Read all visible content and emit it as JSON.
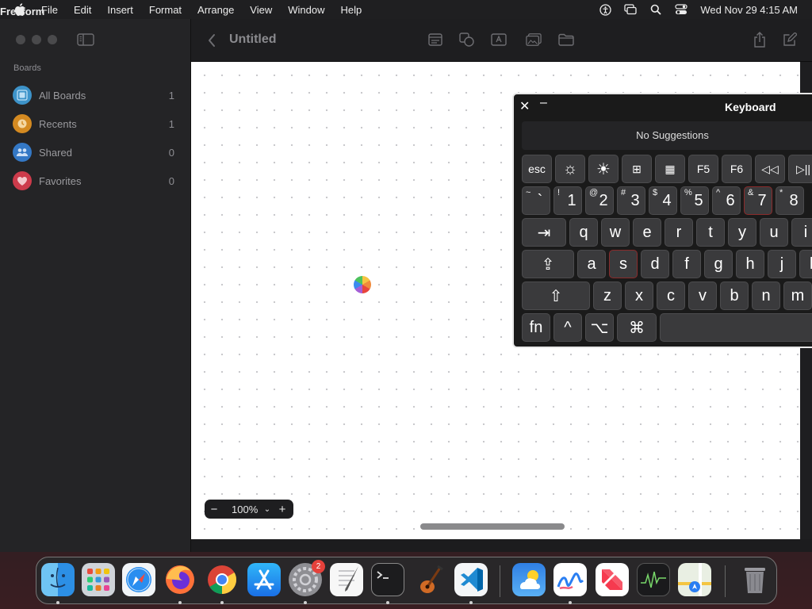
{
  "menubar": {
    "app_name": "Freeform",
    "items": [
      "File",
      "Edit",
      "Insert",
      "Format",
      "Arrange",
      "View",
      "Window",
      "Help"
    ],
    "clock": "Wed Nov 29  4:15 AM"
  },
  "sidebar": {
    "heading": "Boards",
    "items": [
      {
        "label": "All Boards",
        "count": "1",
        "color": "#3d93c9",
        "icon": "grid-boards-icon"
      },
      {
        "label": "Recents",
        "count": "1",
        "color": "#d48a21",
        "icon": "clock-icon"
      },
      {
        "label": "Shared",
        "count": "0",
        "color": "#3478c5",
        "icon": "people-icon"
      },
      {
        "label": "Favorites",
        "count": "0",
        "color": "#cd3b4b",
        "icon": "heart-icon"
      }
    ]
  },
  "toolbar": {
    "title": "Untitled"
  },
  "zoom": {
    "minus": "−",
    "value": "100%",
    "plus": "+"
  },
  "keyboard": {
    "title": "Keyboard",
    "close": "✕",
    "minimize": "–",
    "suggestions": "No Suggestions",
    "fn_row": [
      "esc",
      "☼",
      "☀",
      "⊞",
      "▦",
      "F5",
      "F6",
      "◁◁",
      "▷||"
    ],
    "number_row": [
      {
        "sym": "~",
        "main": "`"
      },
      {
        "sym": "!",
        "main": "1"
      },
      {
        "sym": "@",
        "main": "2"
      },
      {
        "sym": "#",
        "main": "3"
      },
      {
        "sym": "$",
        "main": "4"
      },
      {
        "sym": "%",
        "main": "5"
      },
      {
        "sym": "^",
        "main": "6"
      },
      {
        "sym": "&",
        "main": "7"
      },
      {
        "sym": "*",
        "main": "8"
      }
    ],
    "qwerty_row": [
      "⇥",
      "q",
      "w",
      "e",
      "r",
      "t",
      "y",
      "u",
      "i"
    ],
    "home_row": [
      "⇪",
      "a",
      "s",
      "d",
      "f",
      "g",
      "h",
      "j",
      "k"
    ],
    "shift_row": [
      "⇧",
      "z",
      "x",
      "c",
      "v",
      "b",
      "n",
      "m"
    ],
    "mod_row": [
      "fn",
      "^",
      "⌥",
      "⌘",
      ""
    ]
  },
  "dock": {
    "notification_badge": "2",
    "apps": [
      "finder-icon",
      "launchpad-icon",
      "safari-icon",
      "firefox-icon",
      "chrome-icon",
      "app-store-icon",
      "system-settings-icon",
      "textedit-icon",
      "terminal-icon",
      "instruments-icon",
      "vscode-icon",
      "weather-icon",
      "freeform-icon",
      "news-icon",
      "activity-monitor-icon",
      "maps-icon",
      "trash-icon"
    ]
  }
}
